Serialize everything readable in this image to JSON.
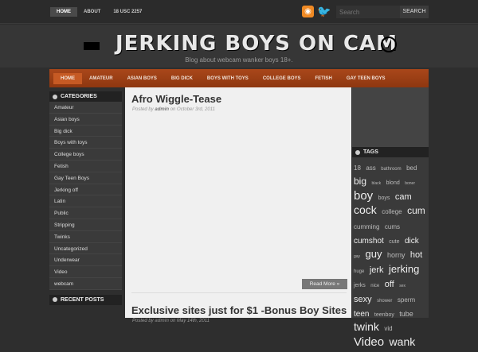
{
  "topnav": [
    "HOME",
    "ABOUT",
    "18 USC 2257"
  ],
  "search": {
    "placeholder": "Search",
    "button": "SEARCH"
  },
  "site": {
    "title": "JERKING BOYS ON CAM",
    "tagline": "Blog about webcam wanker boys 18+."
  },
  "nav": [
    "HOME",
    "AMATEUR",
    "ASIAN BOYS",
    "BIG DICK",
    "BOYS WITH TOYS",
    "COLLEGE BOYS",
    "FETISH",
    "GAY TEEN BOYS"
  ],
  "categories": {
    "title": "CATEGORIES",
    "items": [
      "Amateur",
      "Asian boys",
      "Big dick",
      "Boys with toys",
      "College boys",
      "Fetish",
      "Gay Teen Boys",
      "Jerking off",
      "Latin",
      "Public",
      "Stripping",
      "Twinks",
      "Uncategorized",
      "Underwear",
      "Video",
      "webcam"
    ]
  },
  "recent": {
    "title": "RECENT POSTS"
  },
  "posts": [
    {
      "title": "Afro Wiggle-Tease",
      "posted_by": "Posted by",
      "author": "admin",
      "on": "on October 3rd, 2011",
      "read_more": "Read More »"
    },
    {
      "title": "Exclusive sites just for $1 -Bonus Boy Sites",
      "posted_by": "Posted by",
      "author": "admin",
      "on": "on May 14th, 2011"
    }
  ],
  "tags": {
    "title": "TAGS",
    "items": [
      [
        "18",
        8
      ],
      [
        "ass",
        8
      ],
      [
        "bathroom",
        6
      ],
      [
        "bed",
        8
      ],
      [
        "big",
        12
      ],
      [
        "black",
        5
      ],
      [
        "blond",
        7
      ],
      [
        "boner",
        5
      ],
      [
        "boy",
        15
      ],
      [
        "boys",
        7
      ],
      [
        "cam",
        11
      ],
      [
        "cock",
        14
      ],
      [
        "college",
        8
      ],
      [
        "cum",
        12
      ],
      [
        "cumming",
        8
      ],
      [
        "cums",
        8
      ],
      [
        "cumshot",
        10
      ],
      [
        "cute",
        7
      ],
      [
        "dick",
        10
      ],
      [
        "gay",
        5
      ],
      [
        "guy",
        13
      ],
      [
        "horny",
        9
      ],
      [
        "hot",
        11
      ],
      [
        "huge",
        6
      ],
      [
        "jerk",
        11
      ],
      [
        "jerking",
        13
      ],
      [
        "jerks",
        7
      ],
      [
        "nice",
        6
      ],
      [
        "off",
        11
      ],
      [
        "sex",
        5
      ],
      [
        "sexy",
        11
      ],
      [
        "shower",
        6
      ],
      [
        "sperm",
        8
      ],
      [
        "teen",
        10
      ],
      [
        "teenboy",
        7
      ],
      [
        "tube",
        9
      ],
      [
        "twink",
        14
      ],
      [
        "vid",
        8
      ],
      [
        "Video",
        15
      ],
      [
        "wank",
        14
      ]
    ]
  }
}
